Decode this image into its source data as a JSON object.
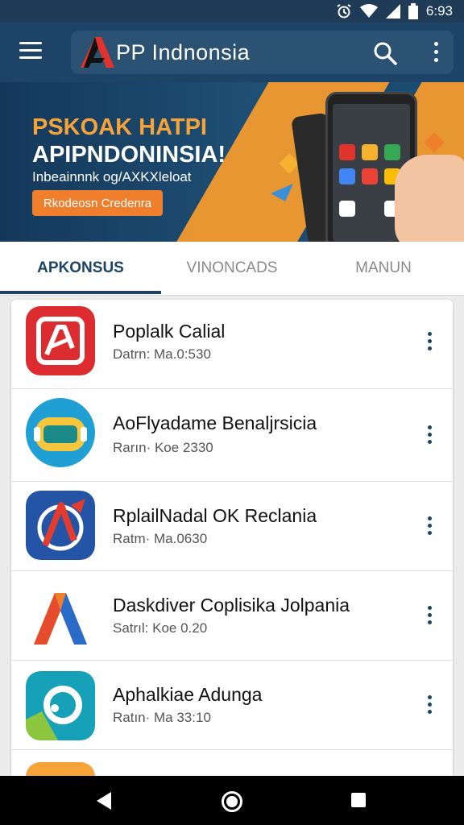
{
  "status_bar": {
    "time": "6:93",
    "icons": [
      "alarm-icon",
      "wifi-icon",
      "signal-icon",
      "battery-icon"
    ]
  },
  "app_bar": {
    "title": "PP Indnonsia",
    "icons": [
      "menu-icon",
      "app-logo",
      "search-icon",
      "more-vert-icon"
    ]
  },
  "banner": {
    "headline1": "PSKOAK HATPI",
    "headline2": "APIPNDONINSIA!",
    "subline": "Inbeainnnk og/AXKXleloat",
    "cta_label": "Rkodeosn Credenra"
  },
  "tabs": [
    {
      "label": "APKONSUS",
      "active": true
    },
    {
      "label": "VINONCADS",
      "active": false
    },
    {
      "label": "MANUN",
      "active": false
    }
  ],
  "apps": [
    {
      "name": "Poplalk Calial",
      "meta": "Datrn: Ma.0:530",
      "icon": "app-icon-red-a"
    },
    {
      "name": "AoFlyadame Benaljrsicia",
      "meta": "Rarın· Koe 2330",
      "icon": "app-icon-robot"
    },
    {
      "name": "RplailNadal OK Reclania",
      "meta": "Ratm· Ma.0630",
      "icon": "app-icon-blue-a"
    },
    {
      "name": "Daskdiver Coplisika Jolpania",
      "meta": "Satrıl: Koe 0.20",
      "icon": "app-icon-orange-a"
    },
    {
      "name": "Aphalkiae Adunga",
      "meta": "Ratın· Ma 33:10",
      "icon": "app-icon-teal-o"
    }
  ],
  "colors": {
    "primary": "#1d4466",
    "accent_orange": "#f07f2d",
    "status_bar": "#1f3b57"
  }
}
